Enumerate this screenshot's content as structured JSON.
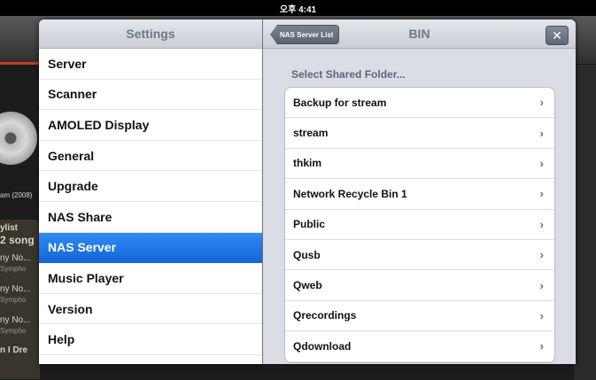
{
  "status_bar": {
    "time": "오후 4:41"
  },
  "background": {
    "fragments": [
      "am (2008)",
      "ylist",
      "2 song",
      "ny No...",
      "Sympho",
      "ny No...",
      "Sympho",
      "ny No...",
      "Sympho",
      "n I Dre"
    ]
  },
  "master": {
    "title": "Settings",
    "items": [
      {
        "label": "Server"
      },
      {
        "label": "Scanner"
      },
      {
        "label": "AMOLED Display"
      },
      {
        "label": "General"
      },
      {
        "label": "Upgrade"
      },
      {
        "label": "NAS Share"
      },
      {
        "label": "NAS Server",
        "selected": true
      },
      {
        "label": "Music Player"
      },
      {
        "label": "Version"
      },
      {
        "label": "Help"
      }
    ]
  },
  "detail": {
    "back_label": "NAS Server List",
    "title": "BIN",
    "close_label": "✕",
    "section_header": "Select Shared Folder...",
    "folders": [
      {
        "label": "Backup for stream"
      },
      {
        "label": "stream"
      },
      {
        "label": "thkim"
      },
      {
        "label": "Network Recycle Bin 1"
      },
      {
        "label": "Public"
      },
      {
        "label": "Qusb"
      },
      {
        "label": "Qweb"
      },
      {
        "label": "Qrecordings"
      },
      {
        "label": "Qdownload"
      }
    ],
    "chevron": "›"
  }
}
